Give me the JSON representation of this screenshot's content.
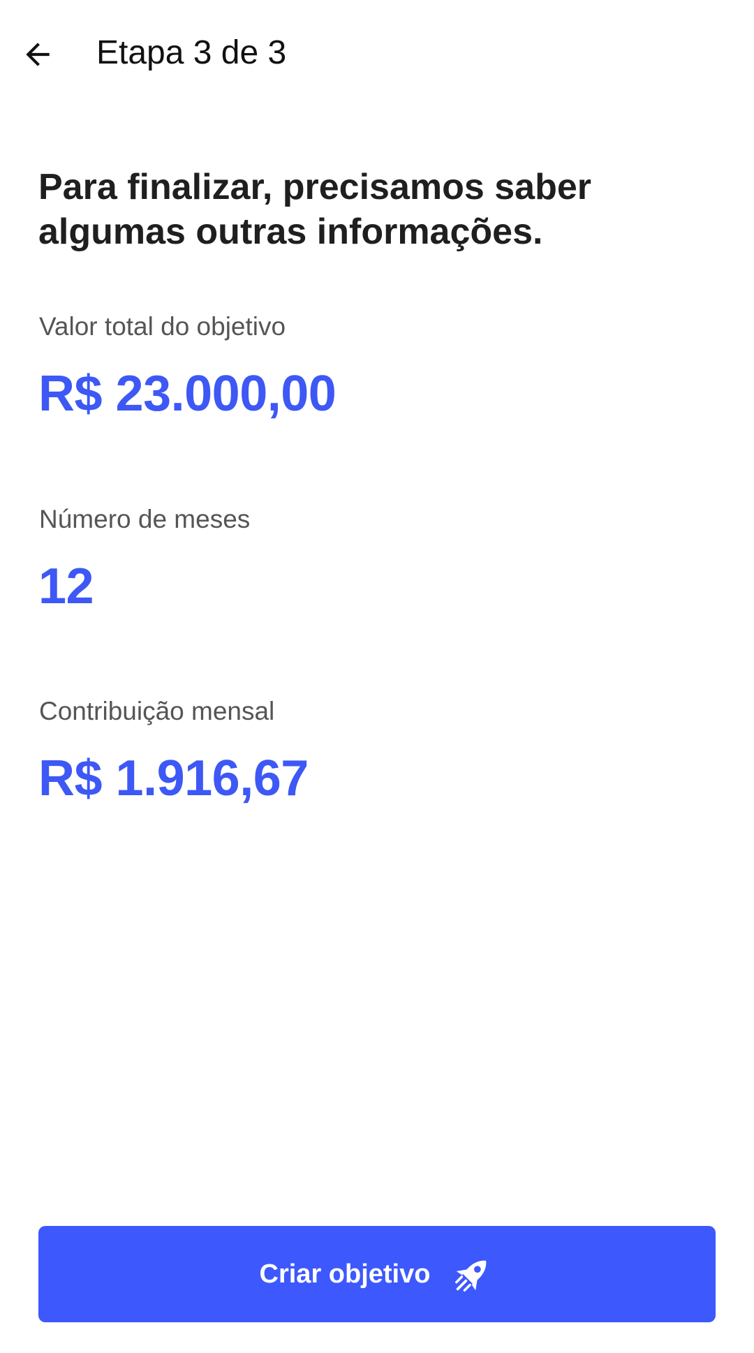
{
  "header": {
    "title": "Etapa 3 de 3",
    "back_icon": "arrow-left-icon"
  },
  "headline": "Para finalizar, precisamos saber algumas outras informações.",
  "fields": {
    "total": {
      "label": "Valor total do objetivo",
      "value": "R$ 23.000,00"
    },
    "months": {
      "label": "Número de meses",
      "value": "12"
    },
    "monthly": {
      "label": "Contribuição mensal",
      "value": "R$ 1.916,67"
    }
  },
  "action": {
    "label": "Criar objetivo",
    "icon": "rocket-icon"
  },
  "colors": {
    "accent": "#3d58fc",
    "value_text": "#3d58f5",
    "label_text": "#555555",
    "heading_text": "#1f1f1f",
    "background": "#ffffff"
  }
}
